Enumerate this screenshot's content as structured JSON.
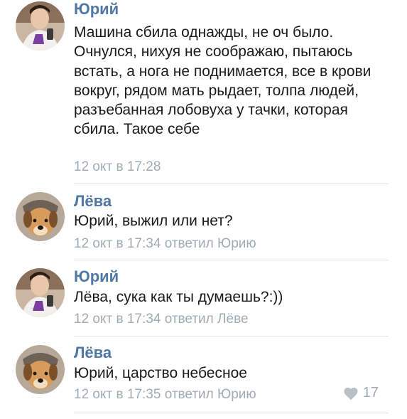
{
  "comments": [
    {
      "author": "Юрий",
      "avatar_icon": "user-photo-avatar",
      "text": "Машина сбила однажды, не оч было. Очнулся, нихуя не соображаю, пытаюсь встать, а нога не поднимается, все в крови вокруг, рядом мать рыдает, толпа людей, разъебанная лобовуха у тачки, которая сбила. Такое себе",
      "date": "12 окт в 17:28",
      "reply": ""
    },
    {
      "author": "Лёва",
      "avatar_icon": "dog-photo-avatar",
      "text": "Юрий, выжил или нет?",
      "date": "12 окт в 17:34",
      "reply": "ответил Юрию"
    },
    {
      "author": "Юрий",
      "avatar_icon": "user-photo-avatar",
      "text": "Лёва, сука как ты думаешь?:))",
      "date": "12 окт в 17:34",
      "reply": "ответил Лёве"
    },
    {
      "author": "Лёва",
      "avatar_icon": "dog-photo-avatar",
      "text": "Юрий, царство небесное",
      "date": "12 окт в 17:35",
      "reply": "ответил Юрию",
      "likes": "17"
    }
  ],
  "colors": {
    "author": "#4f77a3",
    "text": "#1a1a1a",
    "meta": "#a3aab3",
    "divider": "#dfe2e6"
  }
}
